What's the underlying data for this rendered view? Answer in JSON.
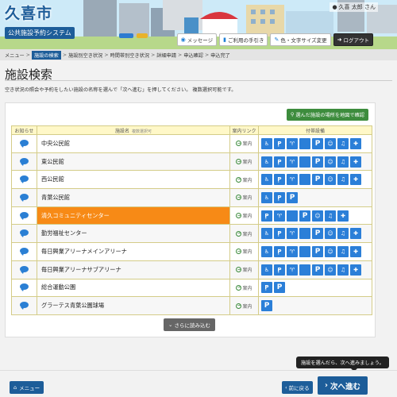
{
  "header": {
    "title": "久喜市",
    "subtitle": "公共施設予約システム",
    "user_name": "久喜 太郎 さん",
    "buttons": [
      {
        "label": "メッセージ",
        "icon": "chat-icon"
      },
      {
        "label": "ご利用の手引き",
        "icon": "book-icon"
      },
      {
        "label": "色・文字サイズ変更",
        "icon": "pencil-icon"
      },
      {
        "label": "ログアウト",
        "icon": "logout-icon"
      }
    ]
  },
  "breadcrumb": {
    "items": [
      "メニュー",
      "施設の検索",
      "施設別空き状況",
      "時間帯別空き状況",
      "詳細申請",
      "申込確認",
      "申込完了"
    ],
    "active_index": 1
  },
  "page": {
    "title": "施設検索",
    "instructions": "空き状況の照会や予約をしたい施設の名称を選んで「次へ進む」を押してください。 複数選択可能です。"
  },
  "map_button": {
    "label": "選んだ施設の場所を地図で確認"
  },
  "table": {
    "headers": {
      "message": "お知らせ",
      "name": "施設名",
      "name_hint": "複数選択可",
      "link": "案内リンク",
      "facilities": "付帯設備"
    },
    "link_label": "案内",
    "rows": [
      {
        "name": "中央公民館",
        "selected": false,
        "fac": [
          "wheelchair-icon",
          "disabled-parking-icon",
          "accessible-toilet-icon",
          "blank-icon",
          "parking-icon",
          "baby-icon",
          "hearing-loop-icon",
          "ostomate-icon"
        ]
      },
      {
        "name": "東公民館",
        "selected": false,
        "fac": [
          "wheelchair-icon",
          "disabled-parking-icon",
          "accessible-toilet-icon",
          "blank-icon",
          "parking-icon",
          "baby-icon",
          "hearing-loop-icon",
          "ostomate-icon"
        ]
      },
      {
        "name": "西公民館",
        "selected": false,
        "fac": [
          "wheelchair-icon",
          "disabled-parking-icon",
          "accessible-toilet-icon",
          "blank-icon",
          "parking-icon",
          "baby-icon",
          "hearing-loop-icon",
          "ostomate-icon"
        ]
      },
      {
        "name": "青葉公民館",
        "selected": false,
        "fac": [
          "wheelchair-icon",
          "disabled-parking-icon",
          "parking-icon"
        ]
      },
      {
        "name": "清久コミュニティセンター",
        "selected": true,
        "fac": [
          "disabled-parking-icon",
          "accessible-toilet-icon",
          "blank-icon",
          "parking-icon",
          "baby-icon",
          "hearing-loop-icon",
          "ostomate-icon"
        ]
      },
      {
        "name": "勤労福祉センター",
        "selected": false,
        "fac": [
          "wheelchair-icon",
          "disabled-parking-icon",
          "accessible-toilet-icon",
          "blank-icon",
          "parking-icon",
          "baby-icon",
          "hearing-loop-icon",
          "ostomate-icon"
        ]
      },
      {
        "name": "毎日興業アリーナメインアリーナ",
        "selected": false,
        "fac": [
          "wheelchair-icon",
          "disabled-parking-icon",
          "accessible-toilet-icon",
          "blank-icon",
          "parking-icon",
          "baby-icon",
          "hearing-loop-icon",
          "ostomate-icon"
        ]
      },
      {
        "name": "毎日興業アリーナサブアリーナ",
        "selected": false,
        "fac": [
          "wheelchair-icon",
          "disabled-parking-icon",
          "accessible-toilet-icon",
          "blank-icon",
          "parking-icon",
          "baby-icon",
          "hearing-loop-icon",
          "ostomate-icon"
        ]
      },
      {
        "name": "総合運動公園",
        "selected": false,
        "fac": [
          "disabled-parking-icon",
          "parking-icon"
        ]
      },
      {
        "name": "グラーテス青葉公園球場",
        "selected": false,
        "fac": [
          "parking-icon"
        ]
      }
    ]
  },
  "more_button": {
    "label": "さらに読み込む"
  },
  "tooltip": {
    "text": "施設を選んだら、次へ進みましょう。"
  },
  "footer": {
    "menu_label": "メニュー",
    "back_label": "前に戻る",
    "next_label": "次へ進む"
  },
  "colors": {
    "primary": "#1d5d99",
    "selected": "#f78a16",
    "map_button": "#3d8c3d",
    "icon_blue": "#2b7fd8",
    "table_header": "#fff8c8"
  }
}
